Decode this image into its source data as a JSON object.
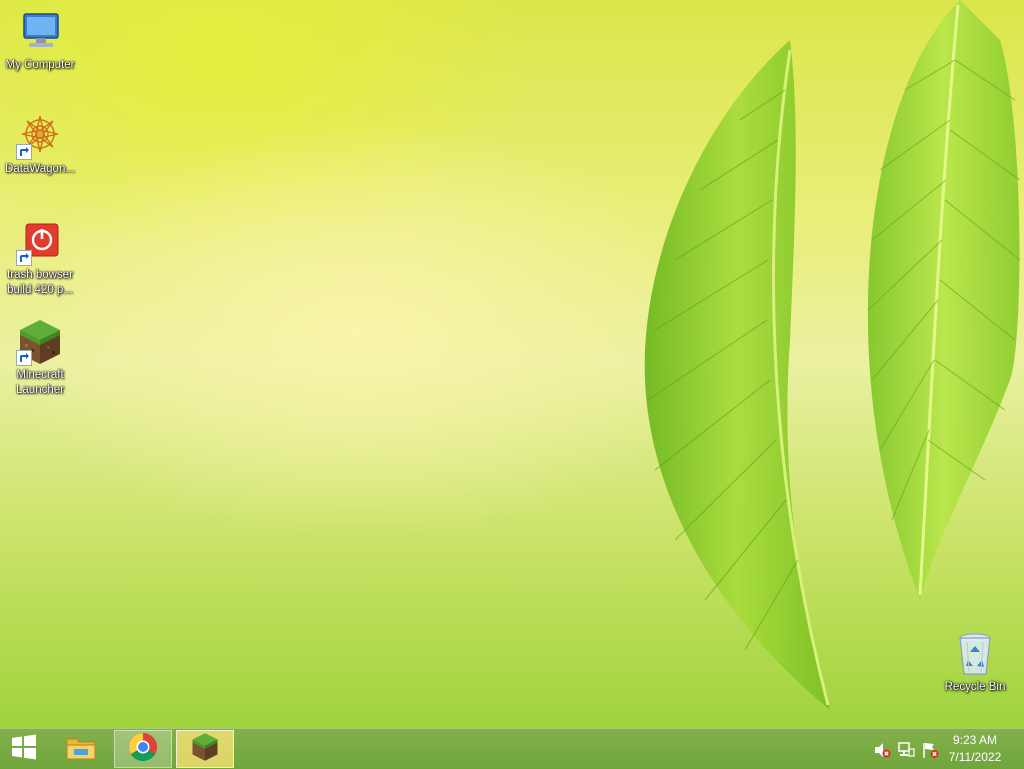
{
  "desktop": {
    "icons": [
      {
        "label": "My Computer",
        "icon": "computer-icon",
        "shortcut": false
      },
      {
        "label": "DataWagon...",
        "icon": "datawagon-icon",
        "shortcut": true
      },
      {
        "label": "trash bowser build 420 p...",
        "icon": "power-app-icon",
        "shortcut": true
      },
      {
        "label": "Minecraft Launcher",
        "icon": "minecraft-icon",
        "shortcut": true
      }
    ],
    "recycle_bin": {
      "label": "Recycle Bin",
      "icon": "recycle-bin-icon"
    }
  },
  "taskbar": {
    "start": {
      "icon": "windows-logo-icon"
    },
    "pinned": [
      {
        "icon": "file-explorer-icon",
        "state": "normal"
      },
      {
        "icon": "chrome-icon",
        "state": "active"
      },
      {
        "icon": "minecraft-icon",
        "state": "highlighted"
      }
    ],
    "tray": [
      {
        "icon": "speaker-muted-icon"
      },
      {
        "icon": "network-icon"
      },
      {
        "icon": "action-center-flag-icon"
      }
    ],
    "clock": {
      "time": "9:23 AM",
      "date": "7/11/2022"
    }
  },
  "colors": {
    "taskbar": "#6fa63a",
    "leaf": "#8ccc2e"
  }
}
